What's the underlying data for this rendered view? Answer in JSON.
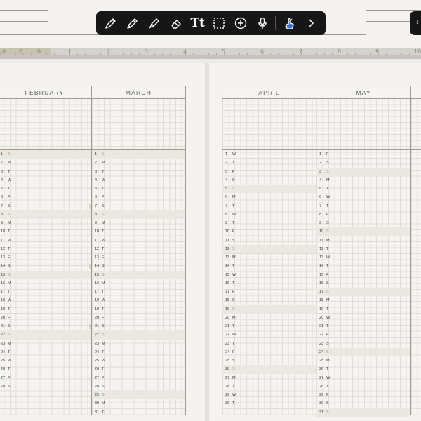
{
  "toolbar": {
    "tools": [
      {
        "icon": "pen-icon"
      },
      {
        "icon": "pencil-icon"
      },
      {
        "icon": "highlighter-icon"
      },
      {
        "icon": "eraser-icon"
      },
      {
        "icon": "text-tool-icon",
        "label": "Tt"
      },
      {
        "icon": "lasso-select-icon"
      },
      {
        "icon": "add-icon"
      },
      {
        "icon": "microphone-icon"
      },
      {
        "icon": "finger-touch-icon"
      },
      {
        "icon": "chevron-right-icon"
      }
    ],
    "colors": {
      "bar": "#161616",
      "icon": "#ffffff",
      "accent": "#3b6fd8"
    }
  },
  "ruler": {
    "labels": [
      "0",
      "0",
      "0",
      "1",
      "2",
      "3",
      "4",
      "5",
      "6",
      "7",
      "8",
      "9",
      "10"
    ]
  },
  "months": [
    {
      "name": "FEBRUARY",
      "days": [
        [
          "1",
          "S"
        ],
        [
          "2",
          "M"
        ],
        [
          "3",
          "T"
        ],
        [
          "4",
          "W"
        ],
        [
          "5",
          "T"
        ],
        [
          "6",
          "F"
        ],
        [
          "7",
          "S"
        ],
        [
          "8",
          "S"
        ],
        [
          "9",
          "M"
        ],
        [
          "10",
          "T"
        ],
        [
          "11",
          "W"
        ],
        [
          "12",
          "T"
        ],
        [
          "13",
          "F"
        ],
        [
          "14",
          "S"
        ],
        [
          "15",
          "S"
        ],
        [
          "16",
          "M"
        ],
        [
          "17",
          "T"
        ],
        [
          "18",
          "W"
        ],
        [
          "19",
          "T"
        ],
        [
          "20",
          "F"
        ],
        [
          "21",
          "S"
        ],
        [
          "22",
          "S"
        ],
        [
          "23",
          "M"
        ],
        [
          "24",
          "T"
        ],
        [
          "25",
          "W"
        ],
        [
          "26",
          "T"
        ],
        [
          "27",
          "F"
        ],
        [
          "28",
          "S"
        ]
      ],
      "highlight": [
        1,
        8,
        15,
        22
      ]
    },
    {
      "name": "MARCH",
      "days": [
        [
          "1",
          "S"
        ],
        [
          "2",
          "M"
        ],
        [
          "3",
          "T"
        ],
        [
          "4",
          "W"
        ],
        [
          "5",
          "T"
        ],
        [
          "6",
          "F"
        ],
        [
          "7",
          "S"
        ],
        [
          "8",
          "S"
        ],
        [
          "9",
          "M"
        ],
        [
          "10",
          "T"
        ],
        [
          "11",
          "W"
        ],
        [
          "12",
          "T"
        ],
        [
          "13",
          "F"
        ],
        [
          "14",
          "S"
        ],
        [
          "15",
          "S"
        ],
        [
          "16",
          "M"
        ],
        [
          "17",
          "T"
        ],
        [
          "18",
          "W"
        ],
        [
          "19",
          "T"
        ],
        [
          "20",
          "F"
        ],
        [
          "21",
          "S"
        ],
        [
          "22",
          "S"
        ],
        [
          "23",
          "M"
        ],
        [
          "24",
          "T"
        ],
        [
          "25",
          "W"
        ],
        [
          "26",
          "T"
        ],
        [
          "27",
          "F"
        ],
        [
          "28",
          "S"
        ],
        [
          "29",
          "S"
        ],
        [
          "30",
          "M"
        ],
        [
          "31",
          "T"
        ]
      ],
      "highlight": [
        1,
        8,
        15,
        22,
        29
      ]
    },
    {
      "name": "APRIL",
      "days": [
        [
          "1",
          "W"
        ],
        [
          "2",
          "T"
        ],
        [
          "3",
          "F"
        ],
        [
          "4",
          "S"
        ],
        [
          "5",
          "S"
        ],
        [
          "6",
          "M"
        ],
        [
          "7",
          "T"
        ],
        [
          "8",
          "W"
        ],
        [
          "9",
          "T"
        ],
        [
          "10",
          "F"
        ],
        [
          "11",
          "S"
        ],
        [
          "12",
          "S"
        ],
        [
          "13",
          "M"
        ],
        [
          "14",
          "T"
        ],
        [
          "15",
          "W"
        ],
        [
          "16",
          "T"
        ],
        [
          "17",
          "F"
        ],
        [
          "18",
          "S"
        ],
        [
          "19",
          "S"
        ],
        [
          "20",
          "M"
        ],
        [
          "21",
          "T"
        ],
        [
          "22",
          "W"
        ],
        [
          "23",
          "T"
        ],
        [
          "24",
          "F"
        ],
        [
          "25",
          "S"
        ],
        [
          "26",
          "S"
        ],
        [
          "27",
          "M"
        ],
        [
          "28",
          "T"
        ],
        [
          "29",
          "W"
        ],
        [
          "30",
          "T"
        ]
      ],
      "highlight": [
        5,
        12,
        19,
        26
      ]
    },
    {
      "name": "MAY",
      "days": [
        [
          "1",
          "F"
        ],
        [
          "2",
          "S"
        ],
        [
          "3",
          "S"
        ],
        [
          "4",
          "M"
        ],
        [
          "5",
          "T"
        ],
        [
          "6",
          "W"
        ],
        [
          "7",
          "T"
        ],
        [
          "8",
          "F"
        ],
        [
          "9",
          "S"
        ],
        [
          "10",
          "S"
        ],
        [
          "11",
          "M"
        ],
        [
          "12",
          "T"
        ],
        [
          "13",
          "W"
        ],
        [
          "14",
          "T"
        ],
        [
          "15",
          "F"
        ],
        [
          "16",
          "S"
        ],
        [
          "17",
          "S"
        ],
        [
          "18",
          "M"
        ],
        [
          "19",
          "T"
        ],
        [
          "20",
          "W"
        ],
        [
          "21",
          "T"
        ],
        [
          "22",
          "F"
        ],
        [
          "23",
          "S"
        ],
        [
          "24",
          "S"
        ],
        [
          "25",
          "M"
        ],
        [
          "26",
          "T"
        ],
        [
          "27",
          "W"
        ],
        [
          "28",
          "T"
        ],
        [
          "29",
          "F"
        ],
        [
          "30",
          "S"
        ],
        [
          "31",
          "S"
        ]
      ],
      "highlight": [
        3,
        10,
        17,
        24,
        31
      ]
    }
  ],
  "colors": {
    "sunday": "#c98d76",
    "highlight_row": "#e9e8e1",
    "grid": "#e0ded7",
    "border": "#9d9b93"
  }
}
